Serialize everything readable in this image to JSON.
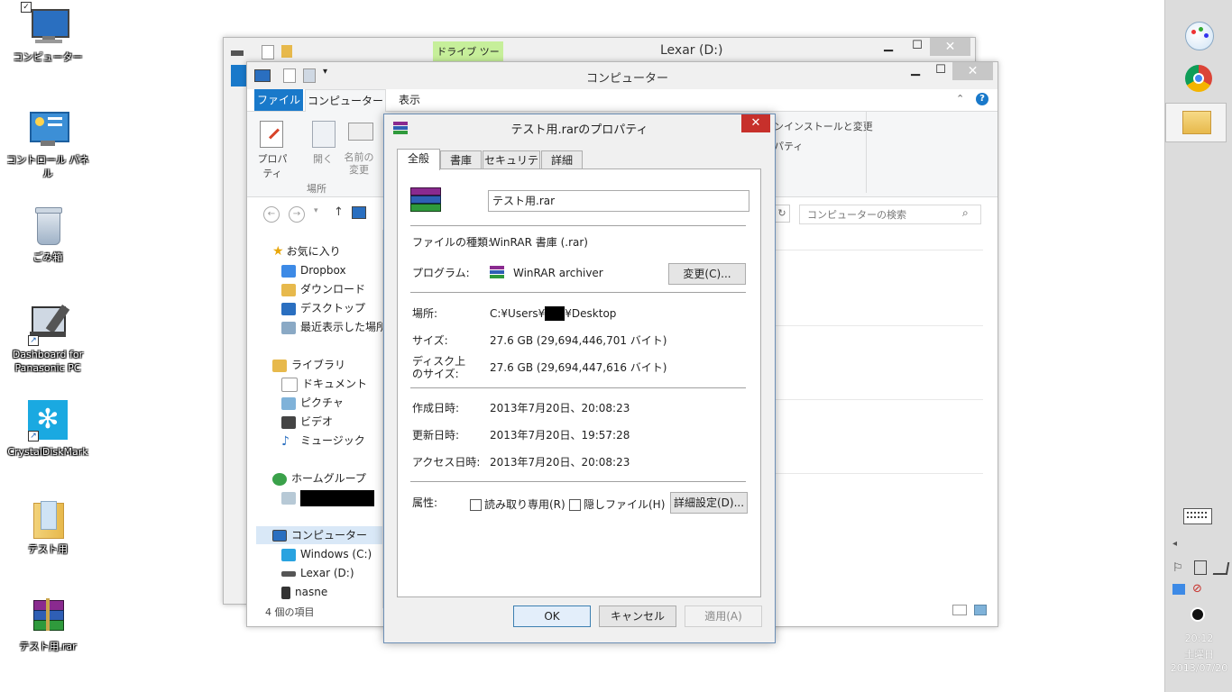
{
  "desktop": {
    "icons": [
      {
        "label": "コンピューター"
      },
      {
        "label": "コントロール パネル"
      },
      {
        "label": "ごみ箱"
      },
      {
        "label": "Dashboard for Panasonic PC"
      },
      {
        "label": "CrystalDiskMark"
      },
      {
        "label": "テスト用"
      },
      {
        "label": "テスト用.rar"
      }
    ]
  },
  "back_window": {
    "title": "Lexar (D:)",
    "tool_tab": "ドライブ ツール",
    "min": "▁",
    "max": "☐",
    "close": "✕"
  },
  "explorer": {
    "title": "コンピューター",
    "ribbon_tabs": [
      "ファイル",
      "コンピューター",
      "表示"
    ],
    "ribbon_buttons": [
      "プロパティ",
      "開く",
      "名前の\n変更"
    ],
    "group_label": "場所",
    "right_ribbon_text1": "ンインストールと変更",
    "right_ribbon_text2": "パティ",
    "search_placeholder": "コンピューターの検索",
    "status": "4 個の項目",
    "nav": {
      "favorites": "お気に入り",
      "dropbox": "Dropbox",
      "downloads": "ダウンロード",
      "desktop": "デスクトップ",
      "recent": "最近表示した場所",
      "libraries": "ライブラリ",
      "documents": "ドキュメント",
      "pictures": "ピクチャ",
      "videos": "ビデオ",
      "music": "ミュージック",
      "homegroup": "ホームグループ",
      "computer": "コンピューター",
      "drive_c": "Windows (C:)",
      "drive_d": "Lexar (D:)",
      "nasne": "nasne"
    }
  },
  "dialog": {
    "title": "テスト用.rarのプロパティ",
    "close": "✕",
    "tabs": [
      "全般",
      "書庫",
      "セキュリティ",
      "詳細"
    ],
    "filename": "テスト用.rar",
    "labels": {
      "type": "ファイルの種類:",
      "program": "プログラム:",
      "location": "場所:",
      "size": "サイズ:",
      "disk_size_1": "ディスク上",
      "disk_size_2": "のサイズ:",
      "created": "作成日時:",
      "modified": "更新日時:",
      "accessed": "アクセス日時:",
      "attributes": "属性:"
    },
    "values": {
      "type": "WinRAR 書庫 (.rar)",
      "program": "WinRAR archiver",
      "location_prefix": "C:¥Users¥",
      "location_suffix": "¥Desktop",
      "size": "27.6 GB (29,694,446,701 バイト)",
      "disk_size": "27.6 GB (29,694,447,616 バイト)",
      "created": "2013年7月20日、20:08:23",
      "modified": "2013年7月20日、19:57:28",
      "accessed": "2013年7月20日、20:08:23"
    },
    "change_button": "変更(C)...",
    "readonly": "読み取り専用(R)",
    "hidden": "隠しファイル(H)",
    "advanced_button": "詳細設定(D)...",
    "ok": "OK",
    "cancel": "キャンセル",
    "apply": "適用(A)"
  },
  "taskbar": {
    "time": "20:12",
    "day": "土曜日",
    "date": "2013/07/20",
    "arrow": "◂"
  },
  "colors": {
    "ribbon_blue": "#1979ca",
    "tool_tab_green": "#c6ef9a",
    "close_red": "#c7302b"
  }
}
